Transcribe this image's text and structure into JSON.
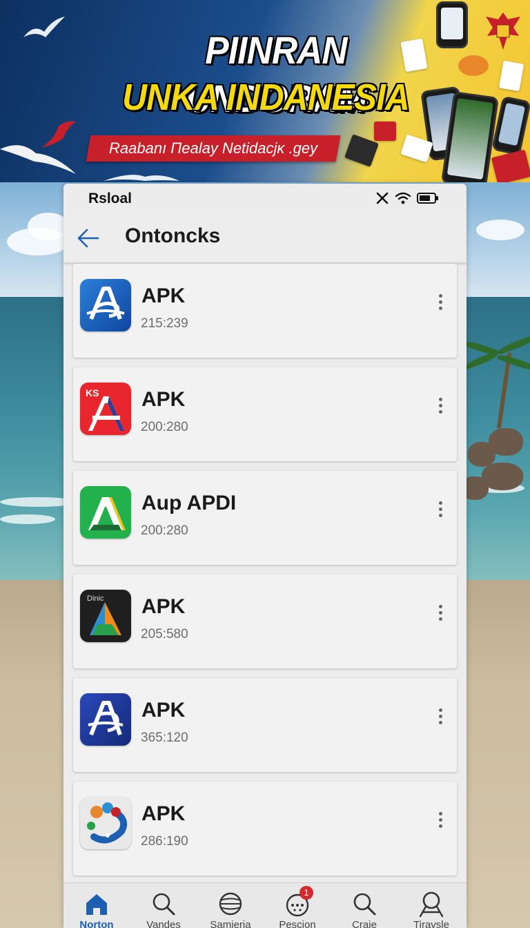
{
  "banner": {
    "title_line1": "PIINRAN UNDORAM",
    "title_line2": "UNKA INDANESIA",
    "ribbon": "Raabanı Πealay  Nеtidacjĸ .gey"
  },
  "status_bar": {
    "carrier": "Rsloal",
    "icons": [
      "close-icon",
      "wifi-icon",
      "battery-icon"
    ]
  },
  "app_bar": {
    "title": "Ontoncks",
    "back_icon": "back-arrow-icon"
  },
  "apps": [
    {
      "name": "APK",
      "meta": "215:239",
      "icon": "blue-a-icon"
    },
    {
      "name": "APK",
      "meta": "200:280",
      "icon": "red-a-icon",
      "icon_badge": "KS"
    },
    {
      "name": "Aup APDI",
      "meta": "200:280",
      "icon": "green-a-icon"
    },
    {
      "name": "APK",
      "meta": "205:580",
      "icon": "dark-a-icon",
      "icon_badge": "Dinic"
    },
    {
      "name": "APK",
      "meta": "365:120",
      "icon": "navy-a-icon"
    },
    {
      "name": "APK",
      "meta": "286:190",
      "icon": "colorful-app-icon"
    }
  ],
  "bottom_nav": [
    {
      "label": "Norton",
      "icon": "home-icon",
      "active": true
    },
    {
      "label": "Vandes",
      "icon": "search-icon"
    },
    {
      "label": "Samieria",
      "icon": "globe-icon"
    },
    {
      "label": "Pescion",
      "icon": "dots-circle-icon",
      "badge": "1"
    },
    {
      "label": "Craie",
      "icon": "search-icon"
    },
    {
      "label": "Tiravsle",
      "icon": "search-person-icon"
    }
  ],
  "colors": {
    "accent": "#1d5fb0",
    "badge": "#d42a2a",
    "banner_yellow": "#f5d90f",
    "banner_red": "#c8202a"
  }
}
